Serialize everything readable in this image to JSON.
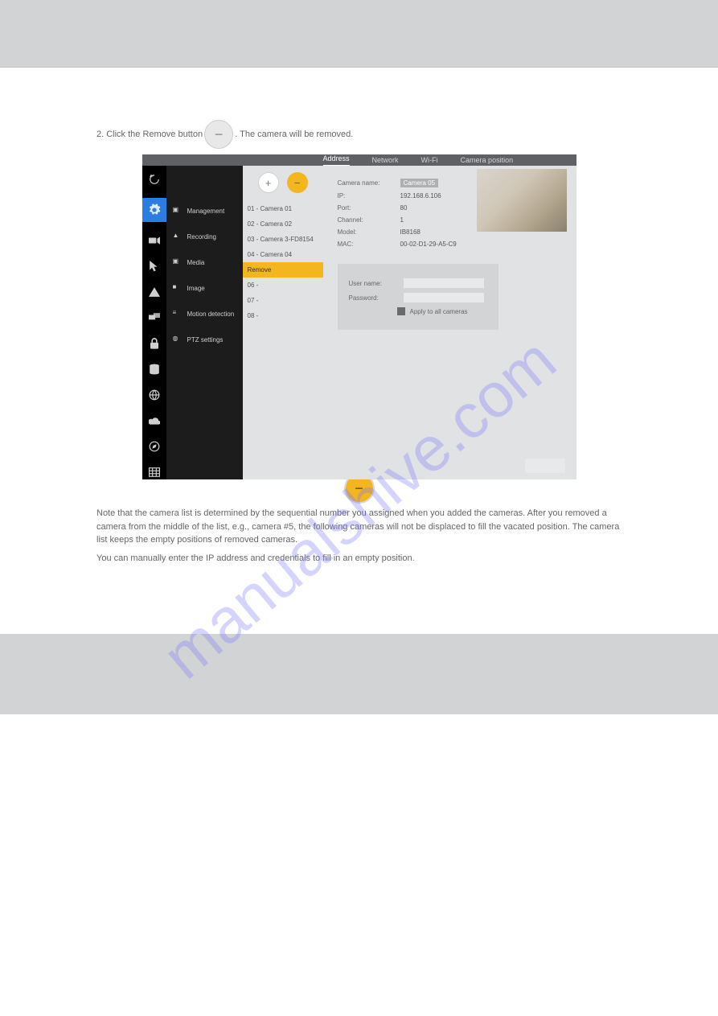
{
  "instruction_before": "2. Click the Remove button",
  "instruction_after": ". The camera will be removed.",
  "post_text": "Note that the camera list is determined by the sequential number you assigned when you added the cameras. After you removed a camera from the middle of the list, e.g., camera #5, the following cameras will not be displaced to fill the vacated position. The camera list keeps the empty positions of removed cameras.",
  "closing_text": "You can manually enter the IP address and credentials to fill in an empty position.",
  "watermark": "manualshive.com",
  "screenshot": {
    "tabs": [
      "Address",
      "Network",
      "Wi-Fi",
      "Camera position"
    ],
    "active_tab": 0,
    "rail_icons": [
      "back",
      "gear",
      "camera",
      "cursor",
      "warn",
      "screens",
      "lock",
      "db",
      "globe",
      "cloud",
      "compass",
      "grid"
    ],
    "sidemenu": [
      "Management",
      "Recording",
      "Media",
      "Image",
      "Motion detection",
      "PTZ settings"
    ],
    "cam_list": [
      "01 - Camera 01",
      "02 - Camera 02",
      "03 - Camera 3-FD8154",
      "04 - Camera 04",
      "Remove",
      "06 -",
      "07 -",
      "08 -"
    ],
    "selected_cam_index": 4,
    "details": {
      "camera_name_label": "Camera name:",
      "camera_name_value": "Camera 05",
      "ip_label": "IP:",
      "ip_value": "192.168.6.106",
      "port_label": "Port:",
      "port_value": "80",
      "channel_label": "Channel:",
      "channel_value": "1",
      "model_label": "Model:",
      "model_value": "IB8168",
      "mac_label": "MAC:",
      "mac_value": "00-02-D1-29-A5-C9",
      "user_label": "User name:",
      "pass_label": "Password:",
      "apply_all": "Apply to all cameras"
    }
  }
}
